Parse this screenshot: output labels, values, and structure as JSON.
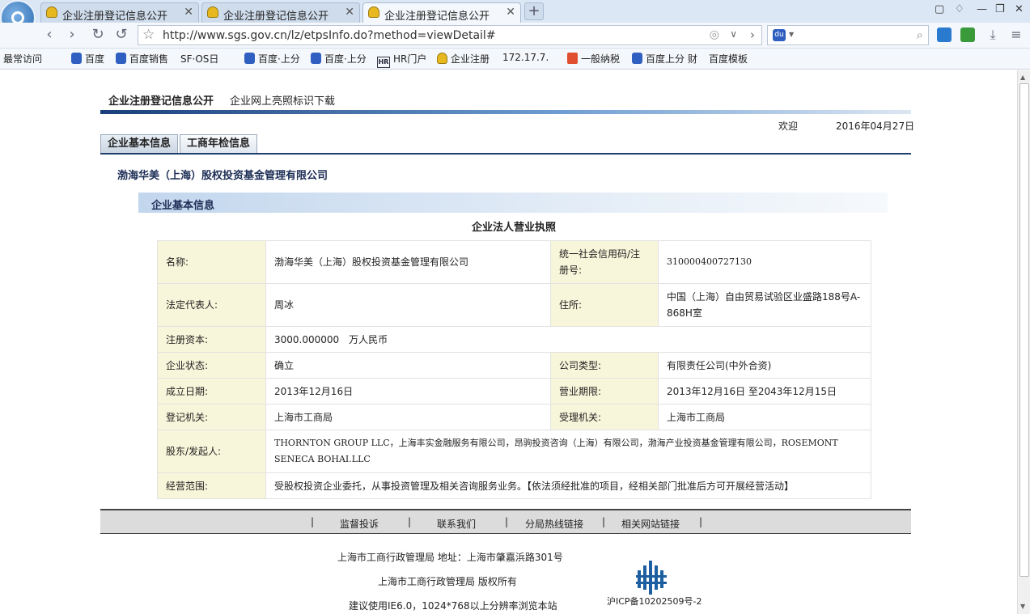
{
  "browser": {
    "tabs": [
      {
        "title": "企业注册登记信息公开",
        "close": "✕"
      },
      {
        "title": "企业注册登记信息公开",
        "close": "✕"
      },
      {
        "title": "企业注册登记信息公开",
        "close": "✕"
      }
    ],
    "new_tab": "+",
    "url": "http://www.sgs.gov.cn/lz/etpsInfo.do?method=viewDetail#",
    "bookmarks": [
      {
        "label": "最常访问",
        "icon": "page-icon"
      },
      {
        "label": "百度",
        "icon": "baidu-icon"
      },
      {
        "label": "百度销售",
        "icon": "baidu-icon"
      },
      {
        "label": "SF·OS日",
        "icon": "page-icon"
      },
      {
        "label": "百度·上分",
        "icon": "baidu-icon"
      },
      {
        "label": "百度·上分",
        "icon": "baidu-icon"
      },
      {
        "label": "HR门户",
        "icon": "hr-icon"
      },
      {
        "label": "企业注册",
        "icon": "gov-icon"
      },
      {
        "label": "172.17.7.",
        "icon": "page-icon"
      },
      {
        "label": "一般纳税",
        "icon": "tax-icon"
      },
      {
        "label": "百度上分 财",
        "icon": "baidu-icon"
      },
      {
        "label": "百度模板",
        "icon": "page-icon"
      }
    ]
  },
  "page": {
    "topnav": [
      "企业注册登记信息公开",
      "企业网上亮照标识下载"
    ],
    "welcome": "欢迎",
    "date": "2016年04月27日",
    "subtabs": [
      "企业基本信息",
      "工商年检信息"
    ],
    "company_name": "渤海华美（上海）股权投资基金管理有限公司",
    "section_title": "企业基本信息",
    "license_title": "企业法人营业执照",
    "table": {
      "name_label": "名称:",
      "name_value": "渤海华美（上海）股权投资基金管理有限公司",
      "credit_label": "统一社会信用码/注册号:",
      "credit_value": "310000400727130",
      "rep_label": "法定代表人:",
      "rep_value": "周冰",
      "addr_label": "住所:",
      "addr_value": "中国（上海）自由贸易试验区业盛路188号A-868H室",
      "capital_label": "注册资本:",
      "capital_value": "3000.000000　万人民币",
      "status_label": "企业状态:",
      "status_value": "确立",
      "type_label": "公司类型:",
      "type_value": "有限责任公司(中外合资)",
      "found_label": "成立日期:",
      "found_value": "2013年12月16日",
      "term_label": "营业期限:",
      "term_value": "2013年12月16日 至2043年12月15日",
      "reg_label": "登记机关:",
      "reg_value": "上海市工商局",
      "accept_label": "受理机关:",
      "accept_value": "上海市工商局",
      "holders_label": "股东/发起人:",
      "holders_value": "THORNTON GROUP LLC，上海丰实金融服务有限公司，昂驹投资咨询（上海）有限公司，渤海产业投资基金管理有限公司，ROSEMONT SENECA BOHAI.LLC",
      "scope_label": "经营范围:",
      "scope_value": "受股权投资企业委托，从事投资管理及相关咨询服务业务。【依法须经批准的项目，经相关部门批准后方可开展经营活动】"
    },
    "footer_links": [
      "监督投诉",
      "联系我们",
      "分局热线链接",
      "相关网站链接"
    ],
    "footer_sep": "|",
    "footer_line1": "上海市工商行政管理局 地址：上海市肇嘉浜路301号",
    "footer_line2": "上海市工商行政管理局 版权所有",
    "footer_line3": "建议使用IE6.0，1024*768以上分辨率浏览本站",
    "icp": "沪ICP备10202509号-2"
  }
}
